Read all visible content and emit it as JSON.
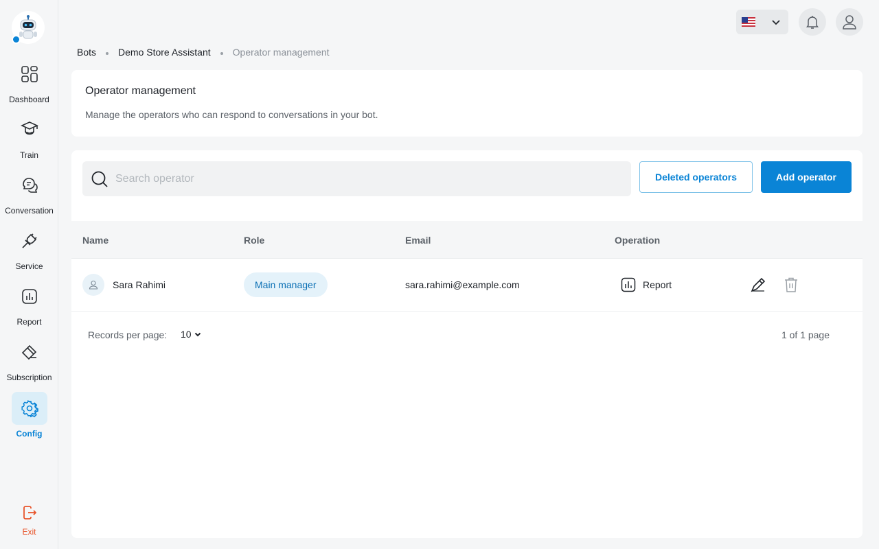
{
  "sidebar": {
    "items": [
      {
        "label": "Dashboard",
        "icon": "dashboard-icon"
      },
      {
        "label": "Train",
        "icon": "graduation-cap-icon"
      },
      {
        "label": "Conversation",
        "icon": "chat-bubbles-icon"
      },
      {
        "label": "Service",
        "icon": "plug-icon"
      },
      {
        "label": "Report",
        "icon": "bar-chart-icon"
      },
      {
        "label": "Subscription",
        "icon": "ticket-icon"
      },
      {
        "label": "Config",
        "icon": "gear-icon",
        "active": true
      }
    ],
    "exit_label": "Exit"
  },
  "topbar": {
    "language_flag": "us-flag-icon"
  },
  "breadcrumb": {
    "items": [
      "Bots",
      "Demo Store Assistant",
      "Operator management"
    ]
  },
  "header": {
    "title": "Operator management",
    "description": "Manage the operators who can respond to conversations in your bot."
  },
  "toolbar": {
    "search_placeholder": "Search operator",
    "deleted_label": "Deleted operators",
    "add_label": "Add operator"
  },
  "table": {
    "columns": [
      "Name",
      "Role",
      "Email",
      "Operation"
    ],
    "rows": [
      {
        "name": "Sara Rahimi",
        "role": "Main manager",
        "email": "sara.rahimi@example.com",
        "operation": "Report"
      }
    ]
  },
  "pagination": {
    "per_page_label": "Records per page:",
    "per_page_value": "10",
    "page_info": "1 of 1 page"
  },
  "colors": {
    "accent": "#0a84d6",
    "exit": "#e8542a"
  }
}
